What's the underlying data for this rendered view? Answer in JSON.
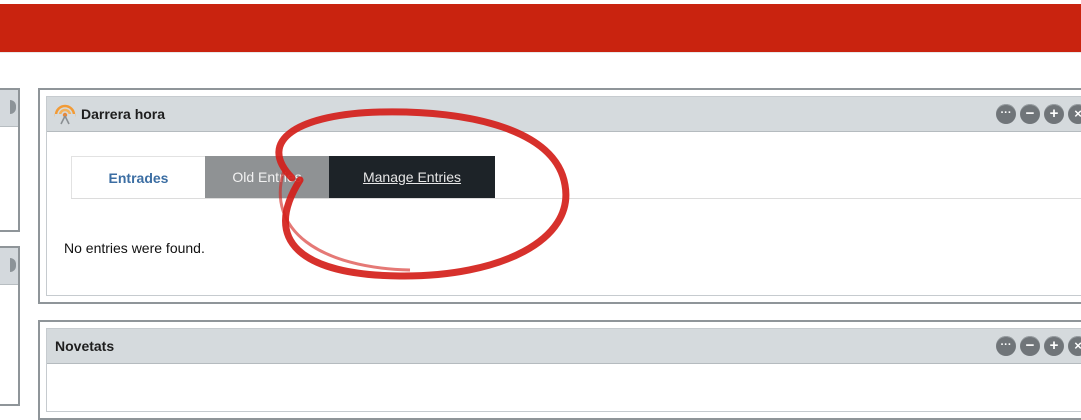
{
  "portlets": [
    {
      "title": "Darrera hora",
      "tabs": [
        "Entrades",
        "Old Entries",
        "Manage Entries"
      ],
      "message": "No entries were found.",
      "controls": [
        "···",
        "−",
        "+",
        "×"
      ]
    },
    {
      "title": "Novetats",
      "controls": [
        "···",
        "−",
        "+",
        "×"
      ]
    }
  ],
  "colors": {
    "topbar": "#c9230f",
    "annotation": "#d41f1a",
    "tab_active_text": "#3c6ea3"
  },
  "icons": {
    "feed": "rss-icon",
    "controls": [
      "more-icon",
      "minimize-icon",
      "maximize-icon",
      "close-icon"
    ]
  }
}
